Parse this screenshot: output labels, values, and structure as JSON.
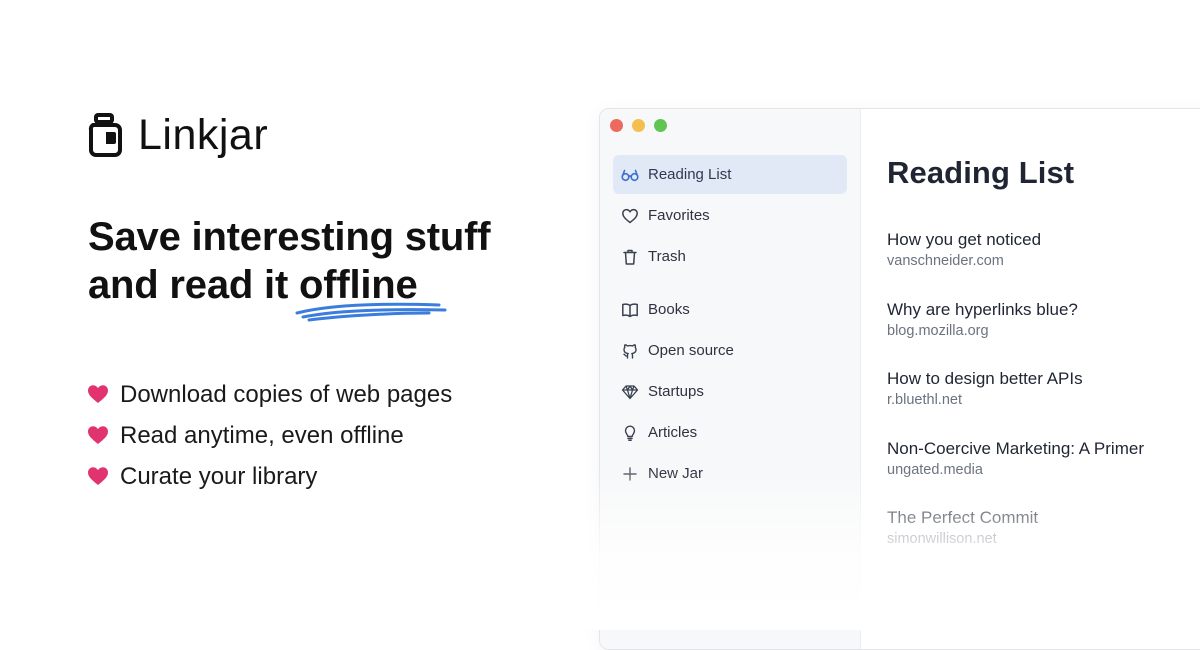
{
  "brand": {
    "name": "Linkjar"
  },
  "headline": {
    "line1": "Save interesting stuff",
    "line2_prefix": "and read it ",
    "line2_emphasis": "offline"
  },
  "features": [
    {
      "icon": "heart-icon",
      "text": "Download copies of web pages"
    },
    {
      "icon": "heart-icon",
      "text": "Read anytime, even offline"
    },
    {
      "icon": "heart-icon",
      "text": "Curate your library"
    }
  ],
  "window": {
    "traffic_lights": [
      "#ec6a5e",
      "#f4bf4f",
      "#61c554"
    ],
    "sidebar": {
      "items": [
        {
          "icon": "glasses-icon",
          "label": "Reading List",
          "active": true
        },
        {
          "icon": "heart-outline-icon",
          "label": "Favorites"
        },
        {
          "icon": "trash-icon",
          "label": "Trash"
        },
        {
          "icon": "book-icon",
          "label": "Books"
        },
        {
          "icon": "github-icon",
          "label": "Open source"
        },
        {
          "icon": "diamond-icon",
          "label": "Startups"
        },
        {
          "icon": "lightbulb-icon",
          "label": "Articles"
        },
        {
          "icon": "plus-icon",
          "label": "New Jar"
        }
      ]
    },
    "content": {
      "title": "Reading List",
      "articles": [
        {
          "title": "How you get noticed",
          "domain": "vanschneider.com"
        },
        {
          "title": "Why are hyperlinks blue?",
          "domain": "blog.mozilla.org"
        },
        {
          "title": "How to design better APIs",
          "domain": "r.bluethl.net"
        },
        {
          "title": "Non-Coercive Marketing: A Primer",
          "domain": "ungated.media"
        },
        {
          "title": "The Perfect Commit",
          "domain": "simonwillison.net"
        }
      ]
    }
  },
  "colors": {
    "accent_heart": "#e0336f",
    "underline": "#3b7ddd",
    "active_nav_bg": "#e1e9f7",
    "active_nav_icon": "#3b6fd1"
  }
}
